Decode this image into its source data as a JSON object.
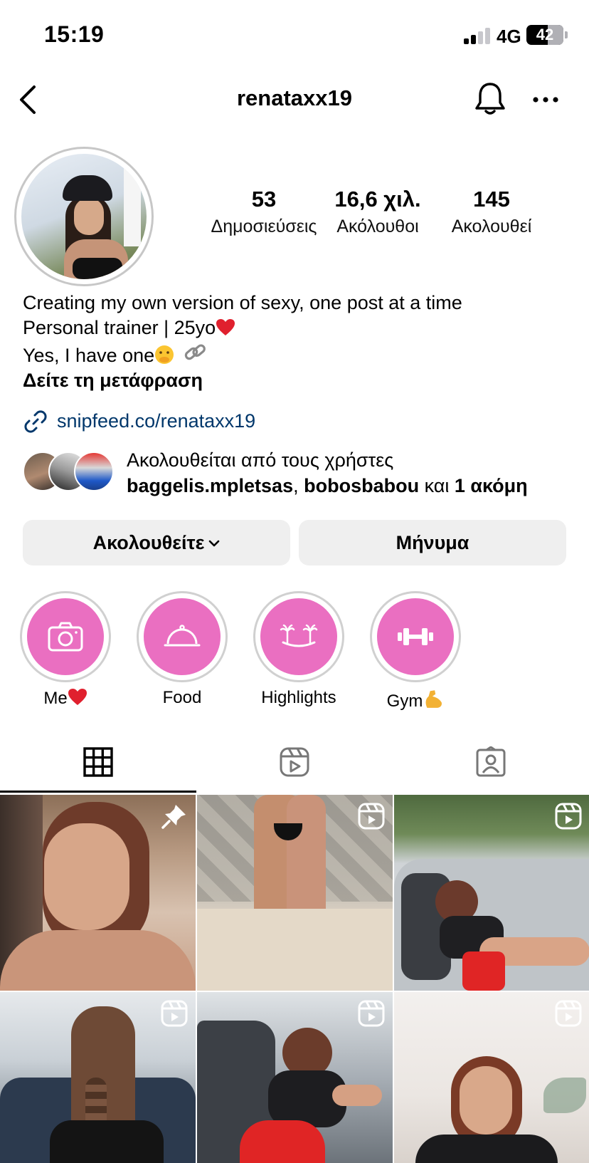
{
  "status_bar": {
    "time": "15:19",
    "network": "4G",
    "battery": "42"
  },
  "nav": {
    "username": "renataxx19",
    "back_icon": "chevron-left-icon",
    "bell_icon": "bell-icon",
    "more_icon": "ellipsis-icon"
  },
  "stats": [
    {
      "value": "53",
      "label": "Δημοσιεύσεις"
    },
    {
      "value": "16,6 χιλ.",
      "label": "Ακόλουθοι"
    },
    {
      "value": "145",
      "label": "Ακολουθεί"
    }
  ],
  "bio": {
    "line1": "Creating my own version of sexy, one post at a time",
    "line2": "Personal trainer | 25yo",
    "line3": "Yes, I have one",
    "translate": "Δείτε τη μετάφραση"
  },
  "link": {
    "text": "snipfeed.co/renataxx19"
  },
  "followed_by": {
    "prefix": "Ακολουθείται από τους χρήστες",
    "user1": "baggelis.mpletsas",
    "sep": ", ",
    "user2": "bobosbabou",
    "and": " και ",
    "more": "1 ακόμη"
  },
  "buttons": {
    "following": "Ακολουθείτε",
    "message": "Μήνυμα"
  },
  "highlights": [
    {
      "label": "Me",
      "icon": "camera-icon"
    },
    {
      "label": "Food",
      "icon": "cloche-icon"
    },
    {
      "label": "Highlights",
      "icon": "palm-trees-icon"
    },
    {
      "label": "Gym",
      "icon": "dumbbell-icon"
    }
  ],
  "tabs": [
    {
      "icon": "grid-icon",
      "active": true
    },
    {
      "icon": "reels-icon",
      "active": false
    },
    {
      "icon": "tagged-icon",
      "active": false
    }
  ],
  "colors": {
    "highlight_pink": "#ea6fc1",
    "link_blue": "#00376b",
    "button_gray": "#efefef"
  },
  "posts": [
    {
      "badge": "pin-icon"
    },
    {
      "badge": "reel-icon"
    },
    {
      "badge": "reel-icon"
    },
    {
      "badge": "reel-icon"
    },
    {
      "badge": "reel-icon"
    },
    {
      "badge": "reel-icon"
    }
  ]
}
